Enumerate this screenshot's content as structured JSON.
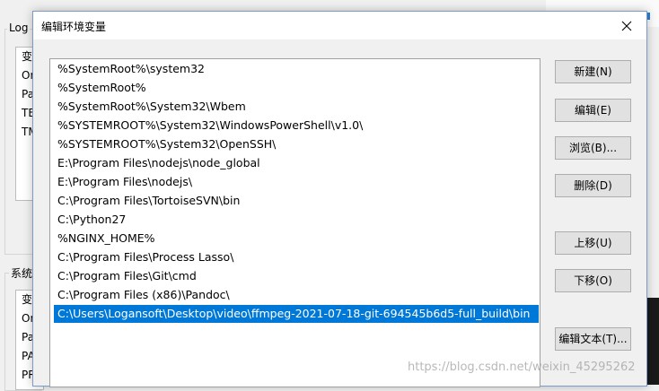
{
  "background": {
    "group1_label": "Log",
    "group1_items": [
      "变",
      "Or",
      "Pa",
      "TE",
      "TM"
    ],
    "group2_label": "系统",
    "group2_items": [
      "变",
      "Or",
      "Pa",
      "PA",
      "PR"
    ]
  },
  "dialog": {
    "title": "编辑环境变量",
    "close_label": "✕",
    "paths": [
      "%SystemRoot%\\system32",
      "%SystemRoot%",
      "%SystemRoot%\\System32\\Wbem",
      "%SYSTEMROOT%\\System32\\WindowsPowerShell\\v1.0\\",
      "%SYSTEMROOT%\\System32\\OpenSSH\\",
      "E:\\Program Files\\nodejs\\node_global",
      "E:\\Program Files\\nodejs\\",
      "C:\\Program Files\\TortoiseSVN\\bin",
      "C:\\Python27",
      "%NGINX_HOME%",
      "C:\\Program Files\\Process Lasso\\",
      "C:\\Program Files\\Git\\cmd",
      "C:\\Program Files (x86)\\Pandoc\\",
      "C:\\Users\\Logansoft\\Desktop\\video\\ffmpeg-2021-07-18-git-694545b6d5-full_build\\bin"
    ],
    "selected_index": 13,
    "buttons": {
      "new": "新建(N)",
      "edit": "编辑(E)",
      "browse": "浏览(B)...",
      "delete": "删除(D)",
      "move_up": "上移(U)",
      "move_down": "下移(O)",
      "edit_text": "编辑文本(T)..."
    }
  },
  "watermark": "https://blog.csdn.net/weixin_45295262",
  "colors": {
    "selection": "#0078d7",
    "button_bg": "#e1e1e1"
  }
}
